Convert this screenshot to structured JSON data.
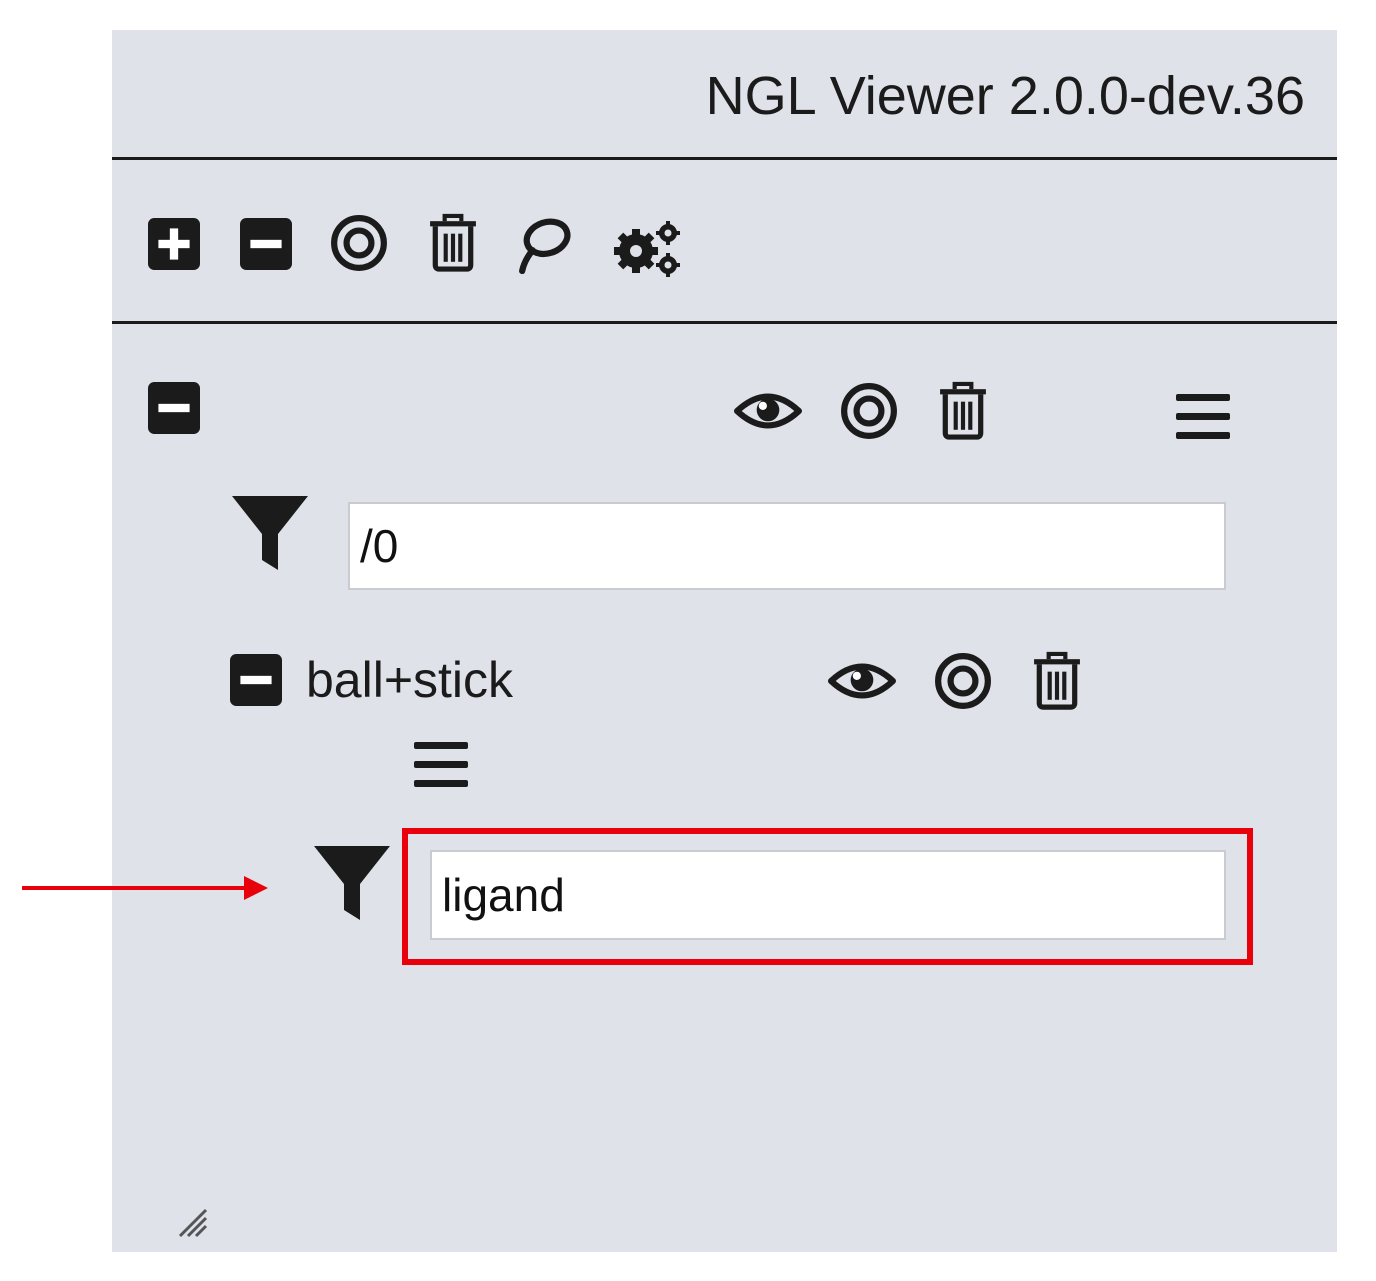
{
  "app": {
    "title": "NGL Viewer 2.0.0-dev.36"
  },
  "toolbar": {
    "icons": [
      "plus-square-icon",
      "minus-square-icon",
      "bullseye-icon",
      "trash-icon",
      "lasso-icon",
      "gears-icon"
    ]
  },
  "component": {
    "filter_value": "/0",
    "icons": [
      "minus-square-icon",
      "eye-icon",
      "bullseye-icon",
      "trash-icon",
      "bars-icon"
    ]
  },
  "representation": {
    "label": "ball+stick",
    "filter_value": "ligand",
    "icons": [
      "minus-square-icon",
      "eye-icon",
      "bullseye-icon",
      "trash-icon",
      "bars-icon",
      "filter-icon"
    ]
  },
  "annotation": {
    "highlight_color": "#e8000b"
  },
  "colors": {
    "panel_background": "#e0e2ea",
    "icon": "#1b1b1b",
    "annotation": "#e8000b"
  }
}
